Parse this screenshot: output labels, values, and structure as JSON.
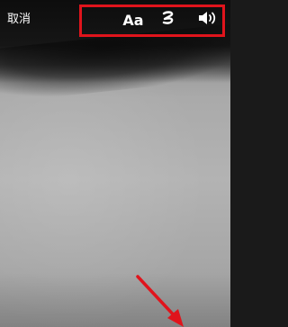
{
  "top_bar": {
    "cancel_label": "取消",
    "tools": {
      "text_label": "Aa",
      "handwrite_icon": "handwriting-squiggle-icon",
      "speaker_icon": "speaker-volume-icon"
    },
    "highlight_color": "#e0141c"
  },
  "annotation": {
    "arrow_icon": "red-arrow-icon",
    "arrow_color": "#e0141c"
  }
}
